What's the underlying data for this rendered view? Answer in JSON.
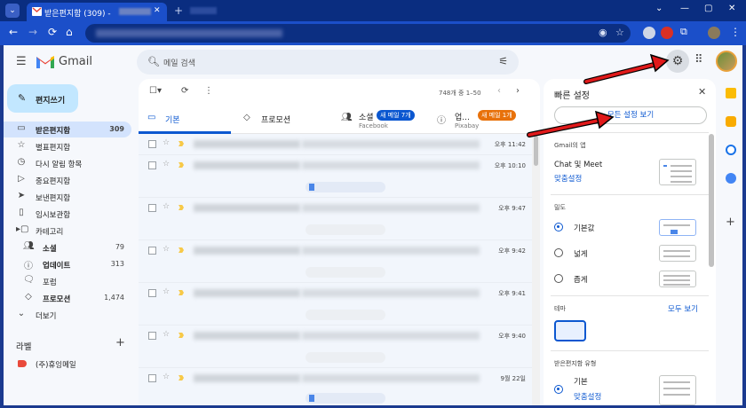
{
  "browser": {
    "tab_title": "받은편지함 (309) -",
    "tab_close": "✕",
    "new_tab": "+",
    "window_controls": [
      "⌄",
      "—",
      "▢",
      "✕"
    ]
  },
  "gmail": {
    "brand": "Gmail",
    "search_placeholder": "메일 검색",
    "compose_label": "편지쓰기",
    "nav": [
      {
        "label": "받은편지함",
        "count": "309",
        "icon": "inbox-icon"
      },
      {
        "label": "별표편지함",
        "count": "",
        "icon": "star-icon"
      },
      {
        "label": "다시 알림 항목",
        "count": "",
        "icon": "clock-icon"
      },
      {
        "label": "중요편지함",
        "count": "",
        "icon": "important-icon"
      },
      {
        "label": "보낸편지함",
        "count": "",
        "icon": "send-icon"
      },
      {
        "label": "임시보관함",
        "count": "",
        "icon": "draft-icon"
      },
      {
        "label": "카테고리",
        "count": "",
        "icon": "label-icon"
      }
    ],
    "categories": [
      {
        "label": "소셜",
        "count": "79"
      },
      {
        "label": "업데이트",
        "count": "313"
      },
      {
        "label": "포럼",
        "count": ""
      },
      {
        "label": "프로모션",
        "count": "1,474"
      }
    ],
    "more_label": "더보기",
    "labels_heading": "라벨",
    "labels": [
      {
        "label": "(주)휴잉메일",
        "color": "#e94a3b"
      }
    ],
    "list": {
      "range": "748개 중 1–50",
      "tabs": [
        {
          "label": "기본"
        },
        {
          "label": "프로모션"
        },
        {
          "label": "소셜",
          "badge": "새 메일 7개",
          "sub": "Facebook",
          "badge_color": "#0b57d0"
        },
        {
          "label": "업...",
          "badge": "새 메일 1개",
          "sub": "Pixabay",
          "badge_color": "#e8710a"
        }
      ],
      "rows": [
        {
          "time": "오후 11:42"
        },
        {
          "time": "오후 10:10"
        },
        {
          "time": "오후 9:47"
        },
        {
          "time": "오후 9:42"
        },
        {
          "time": "오후 9:41"
        },
        {
          "time": "오후 9:40"
        },
        {
          "time": "9월 22일"
        }
      ]
    },
    "quick_settings": {
      "title": "빠른 설정",
      "all_settings": "모든 설정 보기",
      "apps_section": "Gmail의 앱",
      "chat_meet": "Chat 및 Meet",
      "customize": "맞춤설정",
      "density_section": "밀도",
      "density": [
        "기본값",
        "넓게",
        "좁게"
      ],
      "theme_section": "테마",
      "theme_all": "모두 보기",
      "inbox_type_section": "받은편지함 유형",
      "inbox_default": "기본",
      "inbox_customize": "맞춤설정"
    }
  }
}
